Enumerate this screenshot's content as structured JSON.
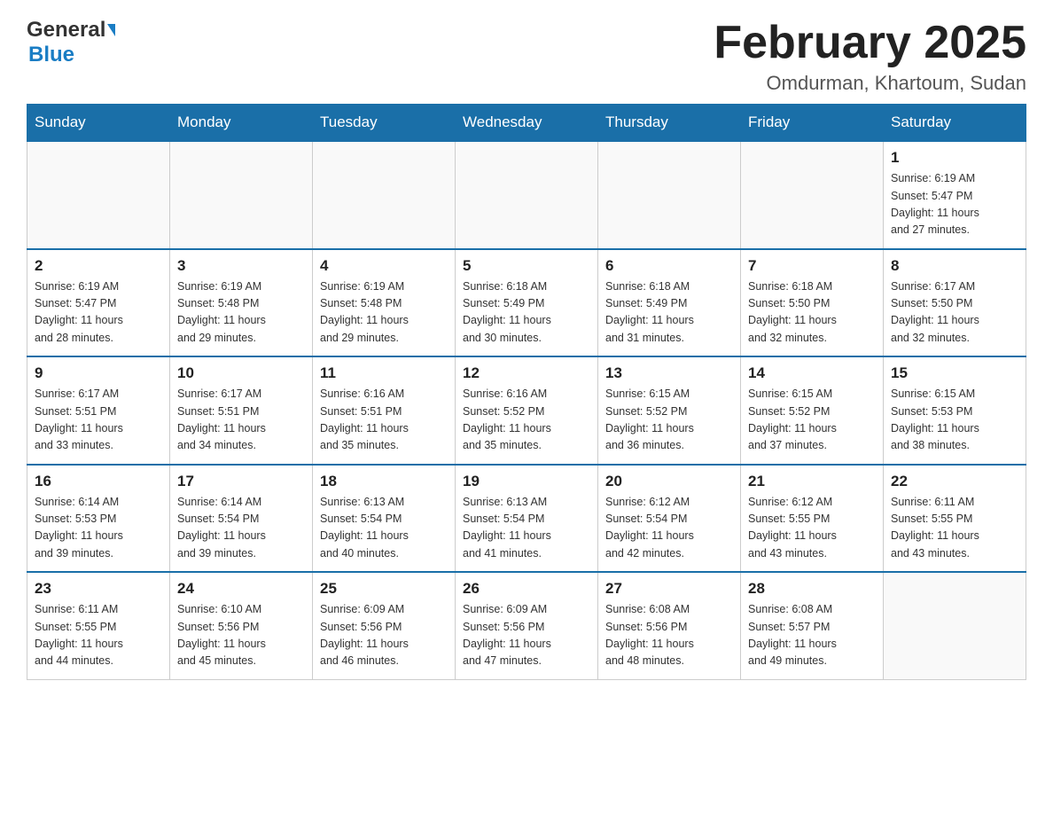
{
  "logo": {
    "general": "General",
    "blue": "Blue"
  },
  "header": {
    "title": "February 2025",
    "subtitle": "Omdurman, Khartoum, Sudan"
  },
  "weekdays": [
    "Sunday",
    "Monday",
    "Tuesday",
    "Wednesday",
    "Thursday",
    "Friday",
    "Saturday"
  ],
  "weeks": [
    [
      {
        "day": "",
        "info": ""
      },
      {
        "day": "",
        "info": ""
      },
      {
        "day": "",
        "info": ""
      },
      {
        "day": "",
        "info": ""
      },
      {
        "day": "",
        "info": ""
      },
      {
        "day": "",
        "info": ""
      },
      {
        "day": "1",
        "info": "Sunrise: 6:19 AM\nSunset: 5:47 PM\nDaylight: 11 hours\nand 27 minutes."
      }
    ],
    [
      {
        "day": "2",
        "info": "Sunrise: 6:19 AM\nSunset: 5:47 PM\nDaylight: 11 hours\nand 28 minutes."
      },
      {
        "day": "3",
        "info": "Sunrise: 6:19 AM\nSunset: 5:48 PM\nDaylight: 11 hours\nand 29 minutes."
      },
      {
        "day": "4",
        "info": "Sunrise: 6:19 AM\nSunset: 5:48 PM\nDaylight: 11 hours\nand 29 minutes."
      },
      {
        "day": "5",
        "info": "Sunrise: 6:18 AM\nSunset: 5:49 PM\nDaylight: 11 hours\nand 30 minutes."
      },
      {
        "day": "6",
        "info": "Sunrise: 6:18 AM\nSunset: 5:49 PM\nDaylight: 11 hours\nand 31 minutes."
      },
      {
        "day": "7",
        "info": "Sunrise: 6:18 AM\nSunset: 5:50 PM\nDaylight: 11 hours\nand 32 minutes."
      },
      {
        "day": "8",
        "info": "Sunrise: 6:17 AM\nSunset: 5:50 PM\nDaylight: 11 hours\nand 32 minutes."
      }
    ],
    [
      {
        "day": "9",
        "info": "Sunrise: 6:17 AM\nSunset: 5:51 PM\nDaylight: 11 hours\nand 33 minutes."
      },
      {
        "day": "10",
        "info": "Sunrise: 6:17 AM\nSunset: 5:51 PM\nDaylight: 11 hours\nand 34 minutes."
      },
      {
        "day": "11",
        "info": "Sunrise: 6:16 AM\nSunset: 5:51 PM\nDaylight: 11 hours\nand 35 minutes."
      },
      {
        "day": "12",
        "info": "Sunrise: 6:16 AM\nSunset: 5:52 PM\nDaylight: 11 hours\nand 35 minutes."
      },
      {
        "day": "13",
        "info": "Sunrise: 6:15 AM\nSunset: 5:52 PM\nDaylight: 11 hours\nand 36 minutes."
      },
      {
        "day": "14",
        "info": "Sunrise: 6:15 AM\nSunset: 5:52 PM\nDaylight: 11 hours\nand 37 minutes."
      },
      {
        "day": "15",
        "info": "Sunrise: 6:15 AM\nSunset: 5:53 PM\nDaylight: 11 hours\nand 38 minutes."
      }
    ],
    [
      {
        "day": "16",
        "info": "Sunrise: 6:14 AM\nSunset: 5:53 PM\nDaylight: 11 hours\nand 39 minutes."
      },
      {
        "day": "17",
        "info": "Sunrise: 6:14 AM\nSunset: 5:54 PM\nDaylight: 11 hours\nand 39 minutes."
      },
      {
        "day": "18",
        "info": "Sunrise: 6:13 AM\nSunset: 5:54 PM\nDaylight: 11 hours\nand 40 minutes."
      },
      {
        "day": "19",
        "info": "Sunrise: 6:13 AM\nSunset: 5:54 PM\nDaylight: 11 hours\nand 41 minutes."
      },
      {
        "day": "20",
        "info": "Sunrise: 6:12 AM\nSunset: 5:54 PM\nDaylight: 11 hours\nand 42 minutes."
      },
      {
        "day": "21",
        "info": "Sunrise: 6:12 AM\nSunset: 5:55 PM\nDaylight: 11 hours\nand 43 minutes."
      },
      {
        "day": "22",
        "info": "Sunrise: 6:11 AM\nSunset: 5:55 PM\nDaylight: 11 hours\nand 43 minutes."
      }
    ],
    [
      {
        "day": "23",
        "info": "Sunrise: 6:11 AM\nSunset: 5:55 PM\nDaylight: 11 hours\nand 44 minutes."
      },
      {
        "day": "24",
        "info": "Sunrise: 6:10 AM\nSunset: 5:56 PM\nDaylight: 11 hours\nand 45 minutes."
      },
      {
        "day": "25",
        "info": "Sunrise: 6:09 AM\nSunset: 5:56 PM\nDaylight: 11 hours\nand 46 minutes."
      },
      {
        "day": "26",
        "info": "Sunrise: 6:09 AM\nSunset: 5:56 PM\nDaylight: 11 hours\nand 47 minutes."
      },
      {
        "day": "27",
        "info": "Sunrise: 6:08 AM\nSunset: 5:56 PM\nDaylight: 11 hours\nand 48 minutes."
      },
      {
        "day": "28",
        "info": "Sunrise: 6:08 AM\nSunset: 5:57 PM\nDaylight: 11 hours\nand 49 minutes."
      },
      {
        "day": "",
        "info": ""
      }
    ]
  ]
}
